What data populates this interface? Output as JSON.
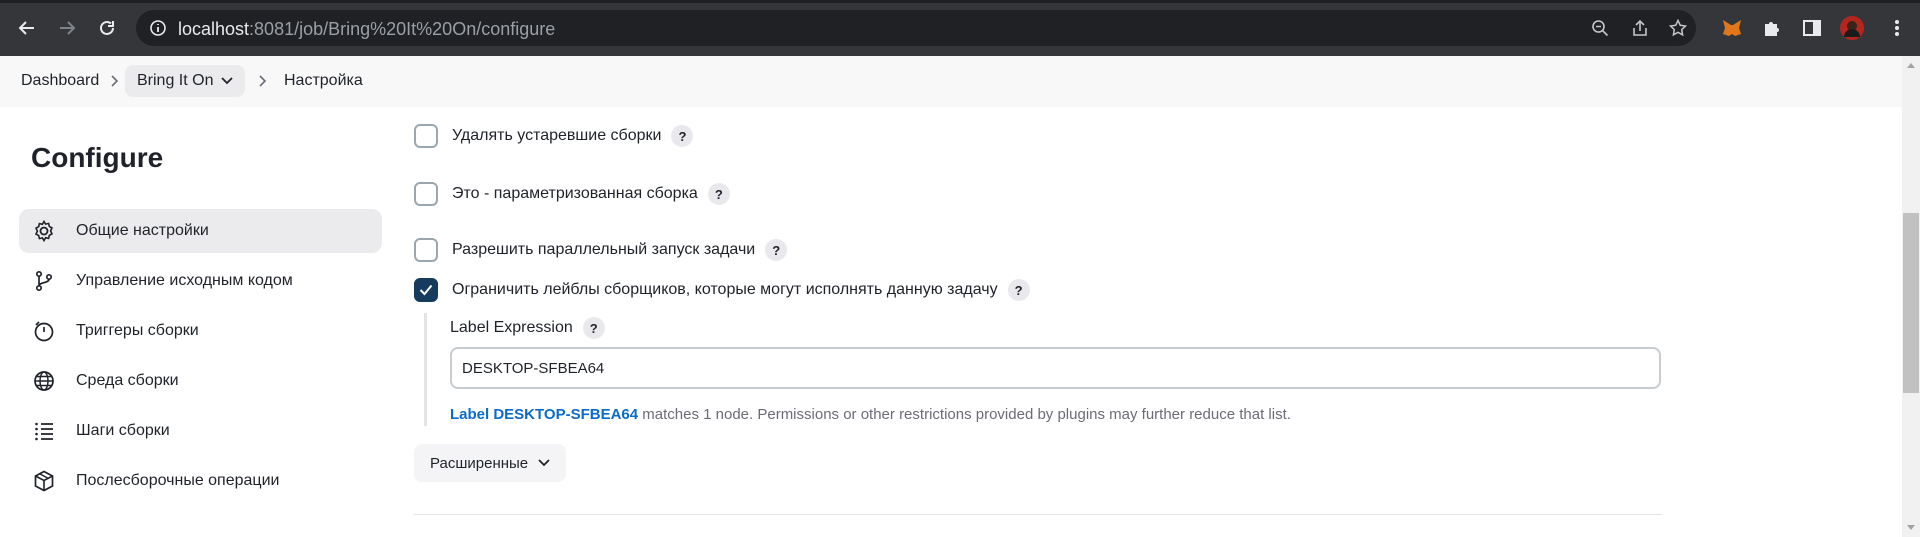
{
  "browser": {
    "url_host": "localhost",
    "url_path": ":8081/job/Bring%20It%20On/configure"
  },
  "breadcrumb": {
    "dashboard": "Dashboard",
    "job": "Bring It On",
    "page": "Настройка"
  },
  "sidebar": {
    "title": "Configure",
    "items": [
      {
        "label": "Общие настройки",
        "icon": "gear-icon",
        "active": true
      },
      {
        "label": "Управление исходным кодом",
        "icon": "git-branch-icon",
        "active": false
      },
      {
        "label": "Триггеры сборки",
        "icon": "timer-icon",
        "active": false
      },
      {
        "label": "Среда сборки",
        "icon": "globe-icon",
        "active": false
      },
      {
        "label": "Шаги сборки",
        "icon": "list-icon",
        "active": false
      },
      {
        "label": "Послесборочные операции",
        "icon": "cube-icon",
        "active": false
      }
    ]
  },
  "form": {
    "options": [
      {
        "label": "Удалять устаревшие сборки",
        "checked": false
      },
      {
        "label": "Это - параметризованная сборка",
        "checked": false
      },
      {
        "label": "Разрешить параллельный запуск задачи",
        "checked": false
      },
      {
        "label": "Ограничить лейблы сборщиков, которые могут исполнять данную задачу",
        "checked": true
      }
    ],
    "help_glyph": "?",
    "label_expression": {
      "title": "Label Expression",
      "value": "DESKTOP-SFBEA64",
      "info_link": "Label DESKTOP-SFBEA64",
      "info_text": " matches 1 node. Permissions or other restrictions provided by plugins may further reduce that list."
    },
    "advanced_label": "Расширенные"
  },
  "colors": {
    "accent": "#163b5f",
    "link": "#0b6bcb",
    "browser_bar": "#35363a"
  }
}
